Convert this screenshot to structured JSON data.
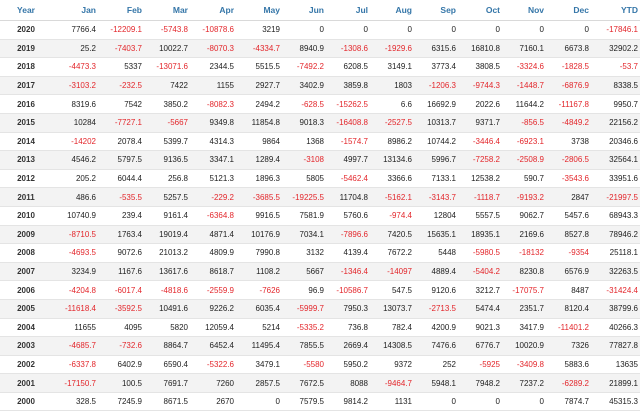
{
  "table": {
    "columns": [
      "Year",
      "Jan",
      "Feb",
      "Mar",
      "Apr",
      "May",
      "Jun",
      "Jul",
      "Aug",
      "Sep",
      "Oct",
      "Nov",
      "Dec",
      "YTD"
    ],
    "negative_color": "#e3262b",
    "header_color": "#3576a8",
    "rows": [
      [
        "2020",
        "7766.4",
        "-12209.1",
        "-5743.8",
        "-10878.6",
        "3219",
        "0",
        "0",
        "0",
        "0",
        "0",
        "0",
        "0",
        "-17846.1"
      ],
      [
        "2019",
        "25.2",
        "-7403.7",
        "10022.7",
        "-8070.3",
        "-4334.7",
        "8940.9",
        "-1308.6",
        "-1929.6",
        "6315.6",
        "16810.8",
        "7160.1",
        "6673.8",
        "32902.2"
      ],
      [
        "2018",
        "-4473.3",
        "5337",
        "-13071.6",
        "2344.5",
        "5515.5",
        "-7492.2",
        "6208.5",
        "3149.1",
        "3773.4",
        "3808.5",
        "-3324.6",
        "-1828.5",
        "-53.7"
      ],
      [
        "2017",
        "-3103.2",
        "-232.5",
        "7422",
        "1155",
        "2927.7",
        "3402.9",
        "3859.8",
        "1803",
        "-1206.3",
        "-9744.3",
        "-1448.7",
        "-6876.9",
        "8338.5"
      ],
      [
        "2016",
        "8319.6",
        "7542",
        "3850.2",
        "-8082.3",
        "2494.2",
        "-628.5",
        "-15262.5",
        "6.6",
        "16692.9",
        "2022.6",
        "11644.2",
        "-11167.8",
        "9950.7"
      ],
      [
        "2015",
        "10284",
        "-7727.1",
        "-5667",
        "9349.8",
        "11854.8",
        "9018.3",
        "-16408.8",
        "-2527.5",
        "10313.7",
        "9371.7",
        "-856.5",
        "-4849.2",
        "22156.2"
      ],
      [
        "2014",
        "-14202",
        "2078.4",
        "5399.7",
        "4314.3",
        "9864",
        "1368",
        "-1574.7",
        "8986.2",
        "10744.2",
        "-3446.4",
        "-6923.1",
        "3738",
        "20346.6"
      ],
      [
        "2013",
        "4546.2",
        "5797.5",
        "9136.5",
        "3347.1",
        "1289.4",
        "-3108",
        "4997.7",
        "13134.6",
        "5996.7",
        "-7258.2",
        "-2508.9",
        "-2806.5",
        "32564.1"
      ],
      [
        "2012",
        "205.2",
        "6044.4",
        "256.8",
        "5121.3",
        "1896.3",
        "5805",
        "-5462.4",
        "3366.6",
        "7133.1",
        "12538.2",
        "590.7",
        "-3543.6",
        "33951.6"
      ],
      [
        "2011",
        "486.6",
        "-535.5",
        "5257.5",
        "-229.2",
        "-3685.5",
        "-19225.5",
        "11704.8",
        "-5162.1",
        "-3143.7",
        "-1118.7",
        "-9193.2",
        "2847",
        "-21997.5"
      ],
      [
        "2010",
        "10740.9",
        "239.4",
        "9161.4",
        "-6364.8",
        "9916.5",
        "7581.9",
        "5760.6",
        "-974.4",
        "12804",
        "5557.5",
        "9062.7",
        "5457.6",
        "68943.3"
      ],
      [
        "2009",
        "-8710.5",
        "1763.4",
        "19019.4",
        "4871.4",
        "10176.9",
        "7034.1",
        "-7896.6",
        "7420.5",
        "15635.1",
        "18935.1",
        "2169.6",
        "8527.8",
        "78946.2"
      ],
      [
        "2008",
        "-4693.5",
        "9072.6",
        "21013.2",
        "4809.9",
        "7990.8",
        "3132",
        "4139.4",
        "7672.2",
        "5448",
        "-5980.5",
        "-18132",
        "-9354",
        "25118.1"
      ],
      [
        "2007",
        "3234.9",
        "1167.6",
        "13617.6",
        "8618.7",
        "1108.2",
        "5667",
        "-1346.4",
        "-14097",
        "4889.4",
        "-5404.2",
        "8230.8",
        "6576.9",
        "32263.5"
      ],
      [
        "2006",
        "-4204.8",
        "-6017.4",
        "-4818.6",
        "-2559.9",
        "-7626",
        "96.9",
        "-10586.7",
        "547.5",
        "9120.6",
        "3212.7",
        "-17075.7",
        "8487",
        "-31424.4"
      ],
      [
        "2005",
        "-11618.4",
        "-3592.5",
        "10491.6",
        "9226.2",
        "6035.4",
        "-5999.7",
        "7950.3",
        "13073.7",
        "-2713.5",
        "5474.4",
        "2351.7",
        "8120.4",
        "38799.6"
      ],
      [
        "2004",
        "11655",
        "4095",
        "5820",
        "12059.4",
        "5214",
        "-5335.2",
        "736.8",
        "782.4",
        "4200.9",
        "9021.3",
        "3417.9",
        "-11401.2",
        "40266.3"
      ],
      [
        "2003",
        "-4685.7",
        "-732.6",
        "8864.7",
        "6452.4",
        "11495.4",
        "7855.5",
        "2669.4",
        "14308.5",
        "7476.6",
        "6776.7",
        "10020.9",
        "7326",
        "77827.8"
      ],
      [
        "2002",
        "-6337.8",
        "6402.9",
        "6590.4",
        "-5322.6",
        "3479.1",
        "-5580",
        "5950.2",
        "9372",
        "252",
        "-5925",
        "-3409.8",
        "5883.6",
        "13635"
      ],
      [
        "2001",
        "-17150.7",
        "100.5",
        "7691.7",
        "7260",
        "2857.5",
        "7672.5",
        "8088",
        "-9464.7",
        "5948.1",
        "7948.2",
        "7237.2",
        "-6289.2",
        "21899.1"
      ],
      [
        "2000",
        "328.5",
        "7245.9",
        "8671.5",
        "2670",
        "0",
        "7579.5",
        "9814.2",
        "1131",
        "0",
        "0",
        "0",
        "7874.7",
        "45315.3"
      ]
    ]
  }
}
